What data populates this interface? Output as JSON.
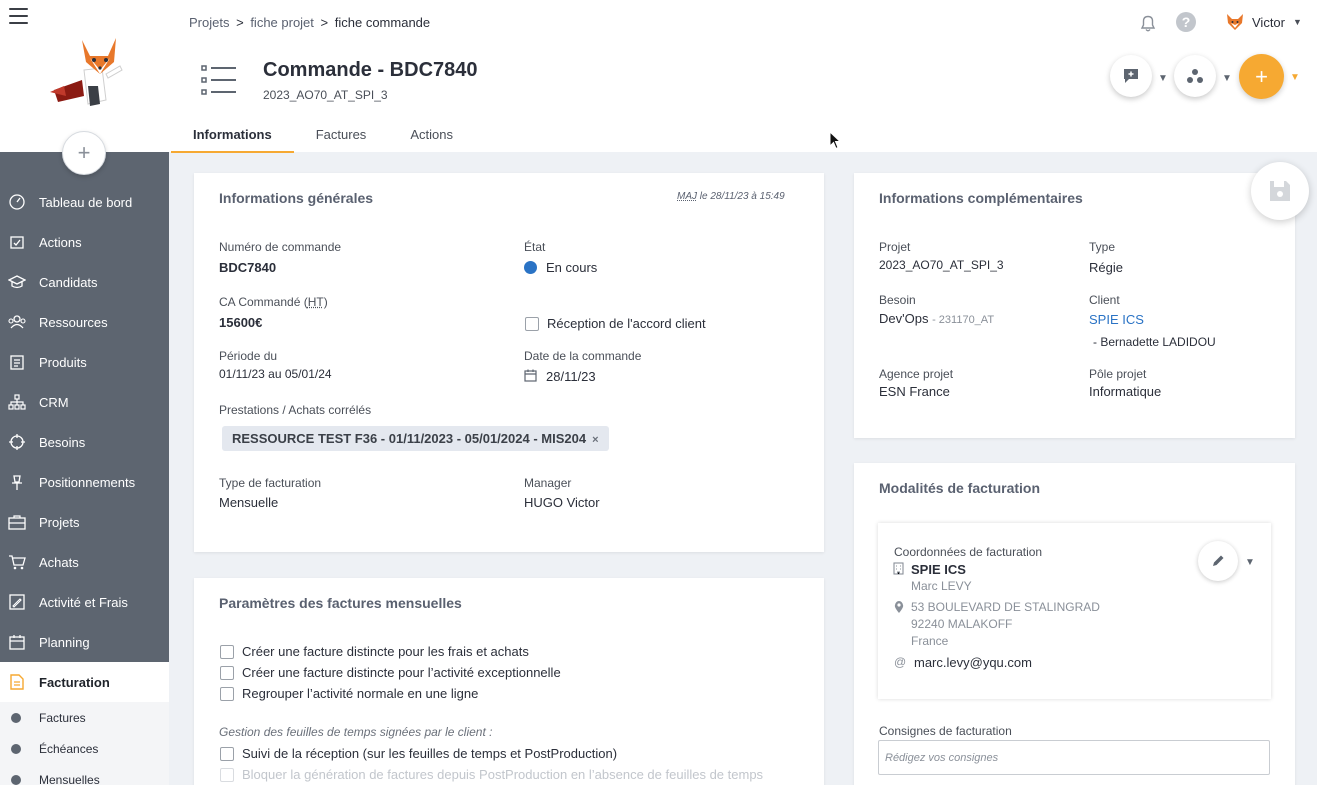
{
  "sidebar": {
    "items": [
      {
        "label": "Tableau de bord",
        "icon": "dashboard-icon"
      },
      {
        "label": "Actions",
        "icon": "actions-icon"
      },
      {
        "label": "Candidats",
        "icon": "candidates-icon"
      },
      {
        "label": "Ressources",
        "icon": "resources-icon"
      },
      {
        "label": "Produits",
        "icon": "products-icon"
      },
      {
        "label": "CRM",
        "icon": "crm-icon"
      },
      {
        "label": "Besoins",
        "icon": "needs-icon"
      },
      {
        "label": "Positionnements",
        "icon": "pin-icon"
      },
      {
        "label": "Projets",
        "icon": "projects-icon"
      },
      {
        "label": "Achats",
        "icon": "cart-icon"
      },
      {
        "label": "Activité et Frais",
        "icon": "activity-icon"
      },
      {
        "label": "Planning",
        "icon": "calendar-icon"
      },
      {
        "label": "Facturation",
        "icon": "billing-icon"
      }
    ],
    "subitems": [
      {
        "label": "Factures"
      },
      {
        "label": "Échéances"
      },
      {
        "label": "Mensuelles"
      }
    ],
    "add_label": "+"
  },
  "header": {
    "breadcrumb": [
      "Projets",
      "fiche projet",
      "fiche commande"
    ],
    "breadcrumb_sep": ">",
    "help": "?",
    "user_name": "Victor",
    "title": "Commande - BDC7840",
    "subtitle": "2023_AO70_AT_SPI_3",
    "plus": "+",
    "tabs": [
      "Informations",
      "Factures",
      "Actions"
    ]
  },
  "general": {
    "title": "Informations générales",
    "maj_prefix": "MAJ",
    "maj_text": "le 28/11/23 à 15:49",
    "order_number_label": "Numéro de commande",
    "order_number": "BDC7840",
    "state_label": "État",
    "state_value": "En cours",
    "ca_label_prefix": "CA Commandé (",
    "ca_label_ht": "HT",
    "ca_label_suffix": ")",
    "ca_value": "15600€",
    "client_accord": "Réception de l'accord client",
    "period_label": "Période du",
    "period_value": "01/11/23 au 05/01/24",
    "date_label": "Date de la commande",
    "date_value": "28/11/23",
    "prestations_label": "Prestations / Achats corrélés",
    "prestation_chip": "RESSOURCE TEST F36 - 01/11/2023 - 05/01/2024 - MIS204",
    "chip_remove": "×",
    "billing_type_label": "Type de facturation",
    "billing_type_value": "Mensuelle",
    "manager_label": "Manager",
    "manager_value": "HUGO Victor"
  },
  "monthly": {
    "title": "Paramètres des factures mensuelles",
    "checks": [
      "Créer une facture distincte pour les frais et achats",
      "Créer une facture distincte pour l’activité exceptionnelle",
      "Regrouper l’activité normale en une ligne"
    ],
    "timesheet_heading": "Gestion des feuilles de temps signées par le client :",
    "timesheet_check": "Suivi de la réception (sur les feuilles de temps et PostProduction)",
    "disabled_check": "Bloquer la génération de factures depuis PostProduction en l’absence de feuilles de temps"
  },
  "complementary": {
    "title": "Informations complémentaires",
    "project_label": "Projet",
    "project_value": "2023_AO70_AT_SPI_3",
    "type_label": "Type",
    "type_value": "Régie",
    "need_label": "Besoin",
    "need_value": "Dev'Ops",
    "need_ref": "- 231170_AT",
    "client_label": "Client",
    "client_value": "SPIE ICS",
    "client_contact": "- Bernadette LADIDOU",
    "agency_label": "Agence projet",
    "agency_value": "ESN France",
    "pole_label": "Pôle projet",
    "pole_value": "Informatique"
  },
  "billing": {
    "title": "Modalités de facturation",
    "coords_label": "Coordonnées de facturation",
    "company": "SPIE ICS",
    "contact": "Marc LEVY",
    "address1": "53 BOULEVARD DE STALINGRAD",
    "address2": "92240 MALAKOFF",
    "country": "France",
    "email": "marc.levy@yqu.com",
    "instructions_label": "Consignes de facturation",
    "instructions_placeholder": "Rédigez vos consignes"
  },
  "colors": {
    "accent": "#f6a932",
    "sidebar": "#5d6570",
    "link": "#2a73c5",
    "status_dot": "#2a73c5"
  }
}
